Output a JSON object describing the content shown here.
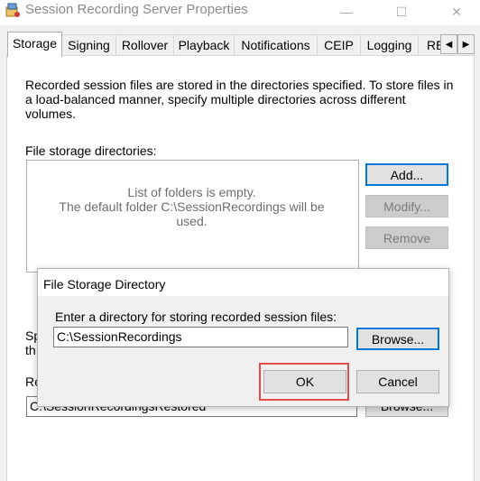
{
  "window": {
    "title": "Session Recording Server Properties",
    "controls": {
      "minimize": "—",
      "maximize": "☐",
      "close": "✕"
    }
  },
  "tabs": [
    {
      "label": "Storage",
      "active": true
    },
    {
      "label": "Signing"
    },
    {
      "label": "Rollover"
    },
    {
      "label": "Playback"
    },
    {
      "label": "Notifications"
    },
    {
      "label": "CEIP"
    },
    {
      "label": "Logging"
    },
    {
      "label": "RE"
    }
  ],
  "tab_scroll": {
    "left": "◀",
    "right": "▶"
  },
  "storage": {
    "description": "Recorded session files are stored in the directories specified. To store files in a load-balanced manner, specify multiple directories across different volumes.",
    "file_storage_label": "File storage directories:",
    "empty_line1": "List of folders is empty.",
    "empty_line2": "The default folder C:\\SessionRecordings will be used.",
    "add_label": "Add...",
    "modify_label": "Modify...",
    "remove_label": "Remove",
    "partial_label_1": "Sp",
    "partial_label_2": "th",
    "partial_label_3": "Re",
    "restore_path": "C:\\SessionRecordingsRestored",
    "browse_label": "Browse..."
  },
  "dialog": {
    "title": "File Storage Directory",
    "prompt": "Enter a directory for storing recorded session files:",
    "directory_value": "C:\\SessionRecordings",
    "browse_label": "Browse...",
    "ok_label": "OK",
    "cancel_label": "Cancel"
  },
  "colors": {
    "highlight": "#e84a4a",
    "focus_border": "#0078d7"
  }
}
